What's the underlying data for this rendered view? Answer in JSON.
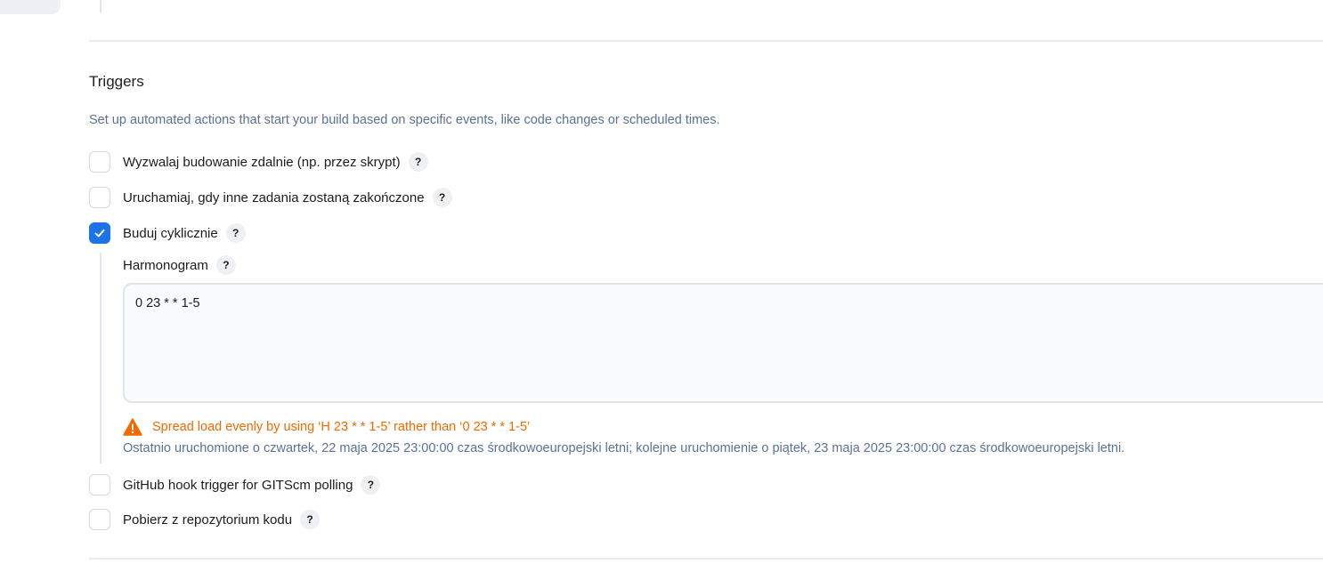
{
  "section": {
    "title": "Triggers",
    "description": "Set up automated actions that start your build based on specific events, like code changes or scheduled times."
  },
  "help_symbol": "?",
  "options": [
    {
      "label": "Wyzwalaj budowanie zdalnie (np. przez skrypt)",
      "checked": false
    },
    {
      "label": "Uruchamiaj, gdy inne zadania zostaną zakończone",
      "checked": false
    },
    {
      "label": "Buduj cyklicznie",
      "checked": true
    },
    {
      "label": "GitHub hook trigger for GITScm polling",
      "checked": false
    },
    {
      "label": "Pobierz z repozytorium kodu",
      "checked": false
    }
  ],
  "schedule": {
    "label": "Harmonogram",
    "value": "0 23 * * 1-5",
    "warning": "Spread load evenly by using ‘H 23 * * 1-5’ rather than ‘0 23 * * 1-5’",
    "info": "Ostatnio uruchomione o czwartek, 22 maja 2025 23:00:00 czas środkowoeuropejski letni; kolejne uruchomienie o piątek, 23 maja 2025 23:00:00 czas środkowoeuropejski letni."
  },
  "colors": {
    "accent": "#1a73e8",
    "warning": "#f06a00",
    "muted_text": "#5a7295"
  },
  "icons": {
    "checkmark": "check-icon",
    "warning": "warning-triangle-icon",
    "help": "help-icon"
  }
}
